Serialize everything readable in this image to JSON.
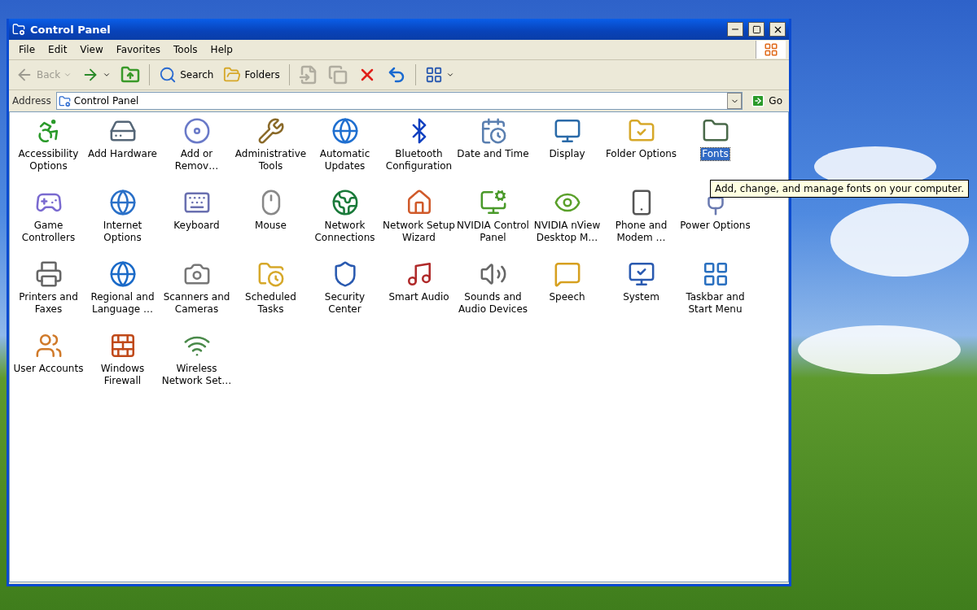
{
  "window": {
    "title": "Control Panel"
  },
  "menu": [
    {
      "label": "File"
    },
    {
      "label": "Edit"
    },
    {
      "label": "View"
    },
    {
      "label": "Favorites"
    },
    {
      "label": "Tools"
    },
    {
      "label": "Help"
    }
  ],
  "toolbar": [
    {
      "kind": "back",
      "label": "Back",
      "disabled": true
    },
    {
      "kind": "forward",
      "disabled": false
    },
    {
      "kind": "icon",
      "disabled": false
    },
    {
      "kind": "sep"
    },
    {
      "kind": "text",
      "label": "Search",
      "disabled": false
    },
    {
      "kind": "text",
      "label": "Folders",
      "disabled": false
    },
    {
      "kind": "sep"
    },
    {
      "kind": "icon",
      "disabled": true
    },
    {
      "kind": "icon",
      "disabled": true
    },
    {
      "kind": "icon",
      "disabled": false
    },
    {
      "kind": "icon",
      "disabled": false
    },
    {
      "kind": "sep"
    },
    {
      "kind": "views",
      "disabled": false
    }
  ],
  "address": {
    "label": "Address",
    "value": "Control Panel",
    "go": "Go"
  },
  "items": [
    {
      "label": "Accessibility Options",
      "selected": false
    },
    {
      "label": "Add Hardware",
      "selected": false
    },
    {
      "label": "Add or Remov…",
      "selected": false
    },
    {
      "label": "Administrative Tools",
      "selected": false
    },
    {
      "label": "Automatic Updates",
      "selected": false
    },
    {
      "label": "Bluetooth Configuration",
      "selected": false
    },
    {
      "label": "Date and Time",
      "selected": false
    },
    {
      "label": "Display",
      "selected": false
    },
    {
      "label": "Folder Options",
      "selected": false
    },
    {
      "label": "Fonts",
      "selected": true
    },
    {
      "label": "Game Controllers",
      "selected": false
    },
    {
      "label": "Internet Options",
      "selected": false
    },
    {
      "label": "Keyboard",
      "selected": false
    },
    {
      "label": "Mouse",
      "selected": false
    },
    {
      "label": "Network Connections",
      "selected": false
    },
    {
      "label": "Network Setup Wizard",
      "selected": false
    },
    {
      "label": "NVIDIA Control Panel",
      "selected": false
    },
    {
      "label": "NVIDIA nView Desktop M…",
      "selected": false
    },
    {
      "label": "Phone and Modem …",
      "selected": false
    },
    {
      "label": "Power Options",
      "selected": false
    },
    {
      "label": "Printers and Faxes",
      "selected": false
    },
    {
      "label": "Regional and Language …",
      "selected": false
    },
    {
      "label": "Scanners and Cameras",
      "selected": false
    },
    {
      "label": "Scheduled Tasks",
      "selected": false
    },
    {
      "label": "Security Center",
      "selected": false
    },
    {
      "label": "Smart Audio",
      "selected": false
    },
    {
      "label": "Sounds and Audio Devices",
      "selected": false
    },
    {
      "label": "Speech",
      "selected": false
    },
    {
      "label": "System",
      "selected": false
    },
    {
      "label": "Taskbar and Start Menu",
      "selected": false
    },
    {
      "label": "User Accounts",
      "selected": false
    },
    {
      "label": "Windows Firewall",
      "selected": false
    },
    {
      "label": "Wireless Network Set…",
      "selected": false
    }
  ],
  "tooltip": "Add, change, and manage fonts on your computer."
}
